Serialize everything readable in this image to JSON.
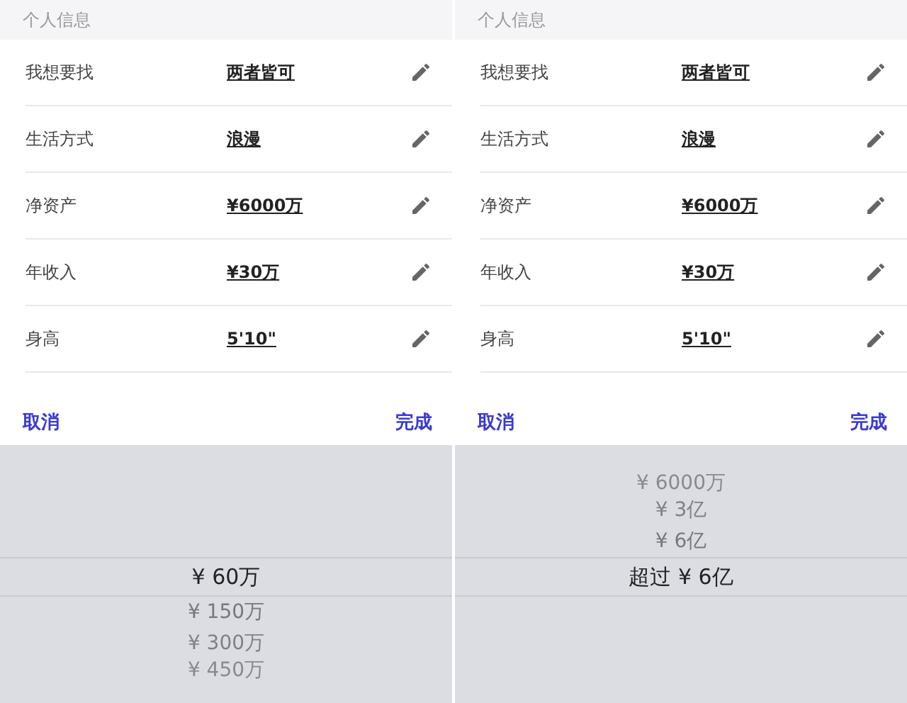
{
  "panels": [
    {
      "section_title": "个人信息",
      "rows": [
        {
          "label": "我想要找",
          "value": "两者皆可"
        },
        {
          "label": "生活方式",
          "value": "浪漫"
        },
        {
          "label": "净资产",
          "value": "¥6000万"
        },
        {
          "label": "年收入",
          "value": "¥30万"
        },
        {
          "label": "身高",
          "value": "5'10\""
        }
      ],
      "toolbar": {
        "cancel": "取消",
        "done": "完成"
      },
      "picker": {
        "options": [
          {
            "label": "¥ 60万",
            "selected": true
          },
          {
            "label": "¥ 150万",
            "selected": false
          },
          {
            "label": "¥ 300万",
            "selected": false
          },
          {
            "label": "¥ 450万",
            "selected": false
          }
        ]
      }
    },
    {
      "section_title": "个人信息",
      "rows": [
        {
          "label": "我想要找",
          "value": "两者皆可"
        },
        {
          "label": "生活方式",
          "value": "浪漫"
        },
        {
          "label": "净资产",
          "value": "¥6000万"
        },
        {
          "label": "年收入",
          "value": "¥30万"
        },
        {
          "label": "身高",
          "value": "5'10\""
        }
      ],
      "toolbar": {
        "cancel": "取消",
        "done": "完成"
      },
      "picker": {
        "options": [
          {
            "label": "¥ 6000万",
            "selected": false
          },
          {
            "label": "¥ 3亿",
            "selected": false
          },
          {
            "label": "¥ 6亿",
            "selected": false
          },
          {
            "label": "超过 ¥ 6亿",
            "selected": true
          }
        ]
      }
    }
  ]
}
